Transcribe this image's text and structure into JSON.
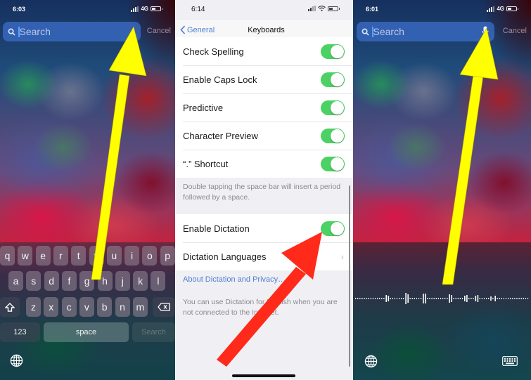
{
  "screen1": {
    "status": {
      "time": "6:03",
      "network": "4G"
    },
    "search": {
      "placeholder": "Search",
      "cancel_label": "Cancel"
    },
    "keyboard": {
      "row1": [
        "q",
        "w",
        "e",
        "r",
        "t",
        "y",
        "u",
        "i",
        "o",
        "p"
      ],
      "row2": [
        "a",
        "s",
        "d",
        "f",
        "g",
        "h",
        "j",
        "k",
        "l"
      ],
      "row3": [
        "z",
        "x",
        "c",
        "v",
        "b",
        "n",
        "m"
      ],
      "numbers_label": "123",
      "space_label": "space",
      "return_label": "Search",
      "icons": {
        "shift": "shift-icon",
        "delete": "delete-icon",
        "globe": "globe-icon"
      }
    },
    "annotation": {
      "type": "arrow",
      "color": "#ffff00",
      "points_to": "search-bar"
    }
  },
  "screen2": {
    "status": {
      "time": "6:14"
    },
    "nav": {
      "back_label": "General",
      "title": "Keyboards"
    },
    "toggles": [
      {
        "label": "Check Spelling",
        "on": true
      },
      {
        "label": "Enable Caps Lock",
        "on": true
      },
      {
        "label": "Predictive",
        "on": true
      },
      {
        "label": "Character Preview",
        "on": true
      },
      {
        "label": "“.” Shortcut",
        "on": true
      }
    ],
    "shortcut_footnote": "Double tapping the space bar will insert a period followed by a space.",
    "dictation": {
      "enable_label": "Enable Dictation",
      "enable_on": true,
      "languages_label": "Dictation Languages",
      "about_link": "About Dictation and Privacy…",
      "footnote": "You can use Dictation for English when you are not connected to the Internet."
    },
    "accent_color": "#4cd164",
    "annotation": {
      "type": "arrow",
      "color": "#ff2a1a",
      "points_to": "enable-dictation-toggle"
    }
  },
  "screen3": {
    "status": {
      "time": "6:01",
      "network": "4G"
    },
    "search": {
      "placeholder": "Search",
      "cancel_label": "Cancel",
      "mic_icon": "microphone-icon"
    },
    "dictation_wave": "listening",
    "icons": {
      "globe": "globe-icon",
      "keyboard": "keyboard-icon"
    },
    "annotation": {
      "type": "arrow",
      "color": "#ffff00",
      "points_to": "microphone-icon"
    }
  }
}
